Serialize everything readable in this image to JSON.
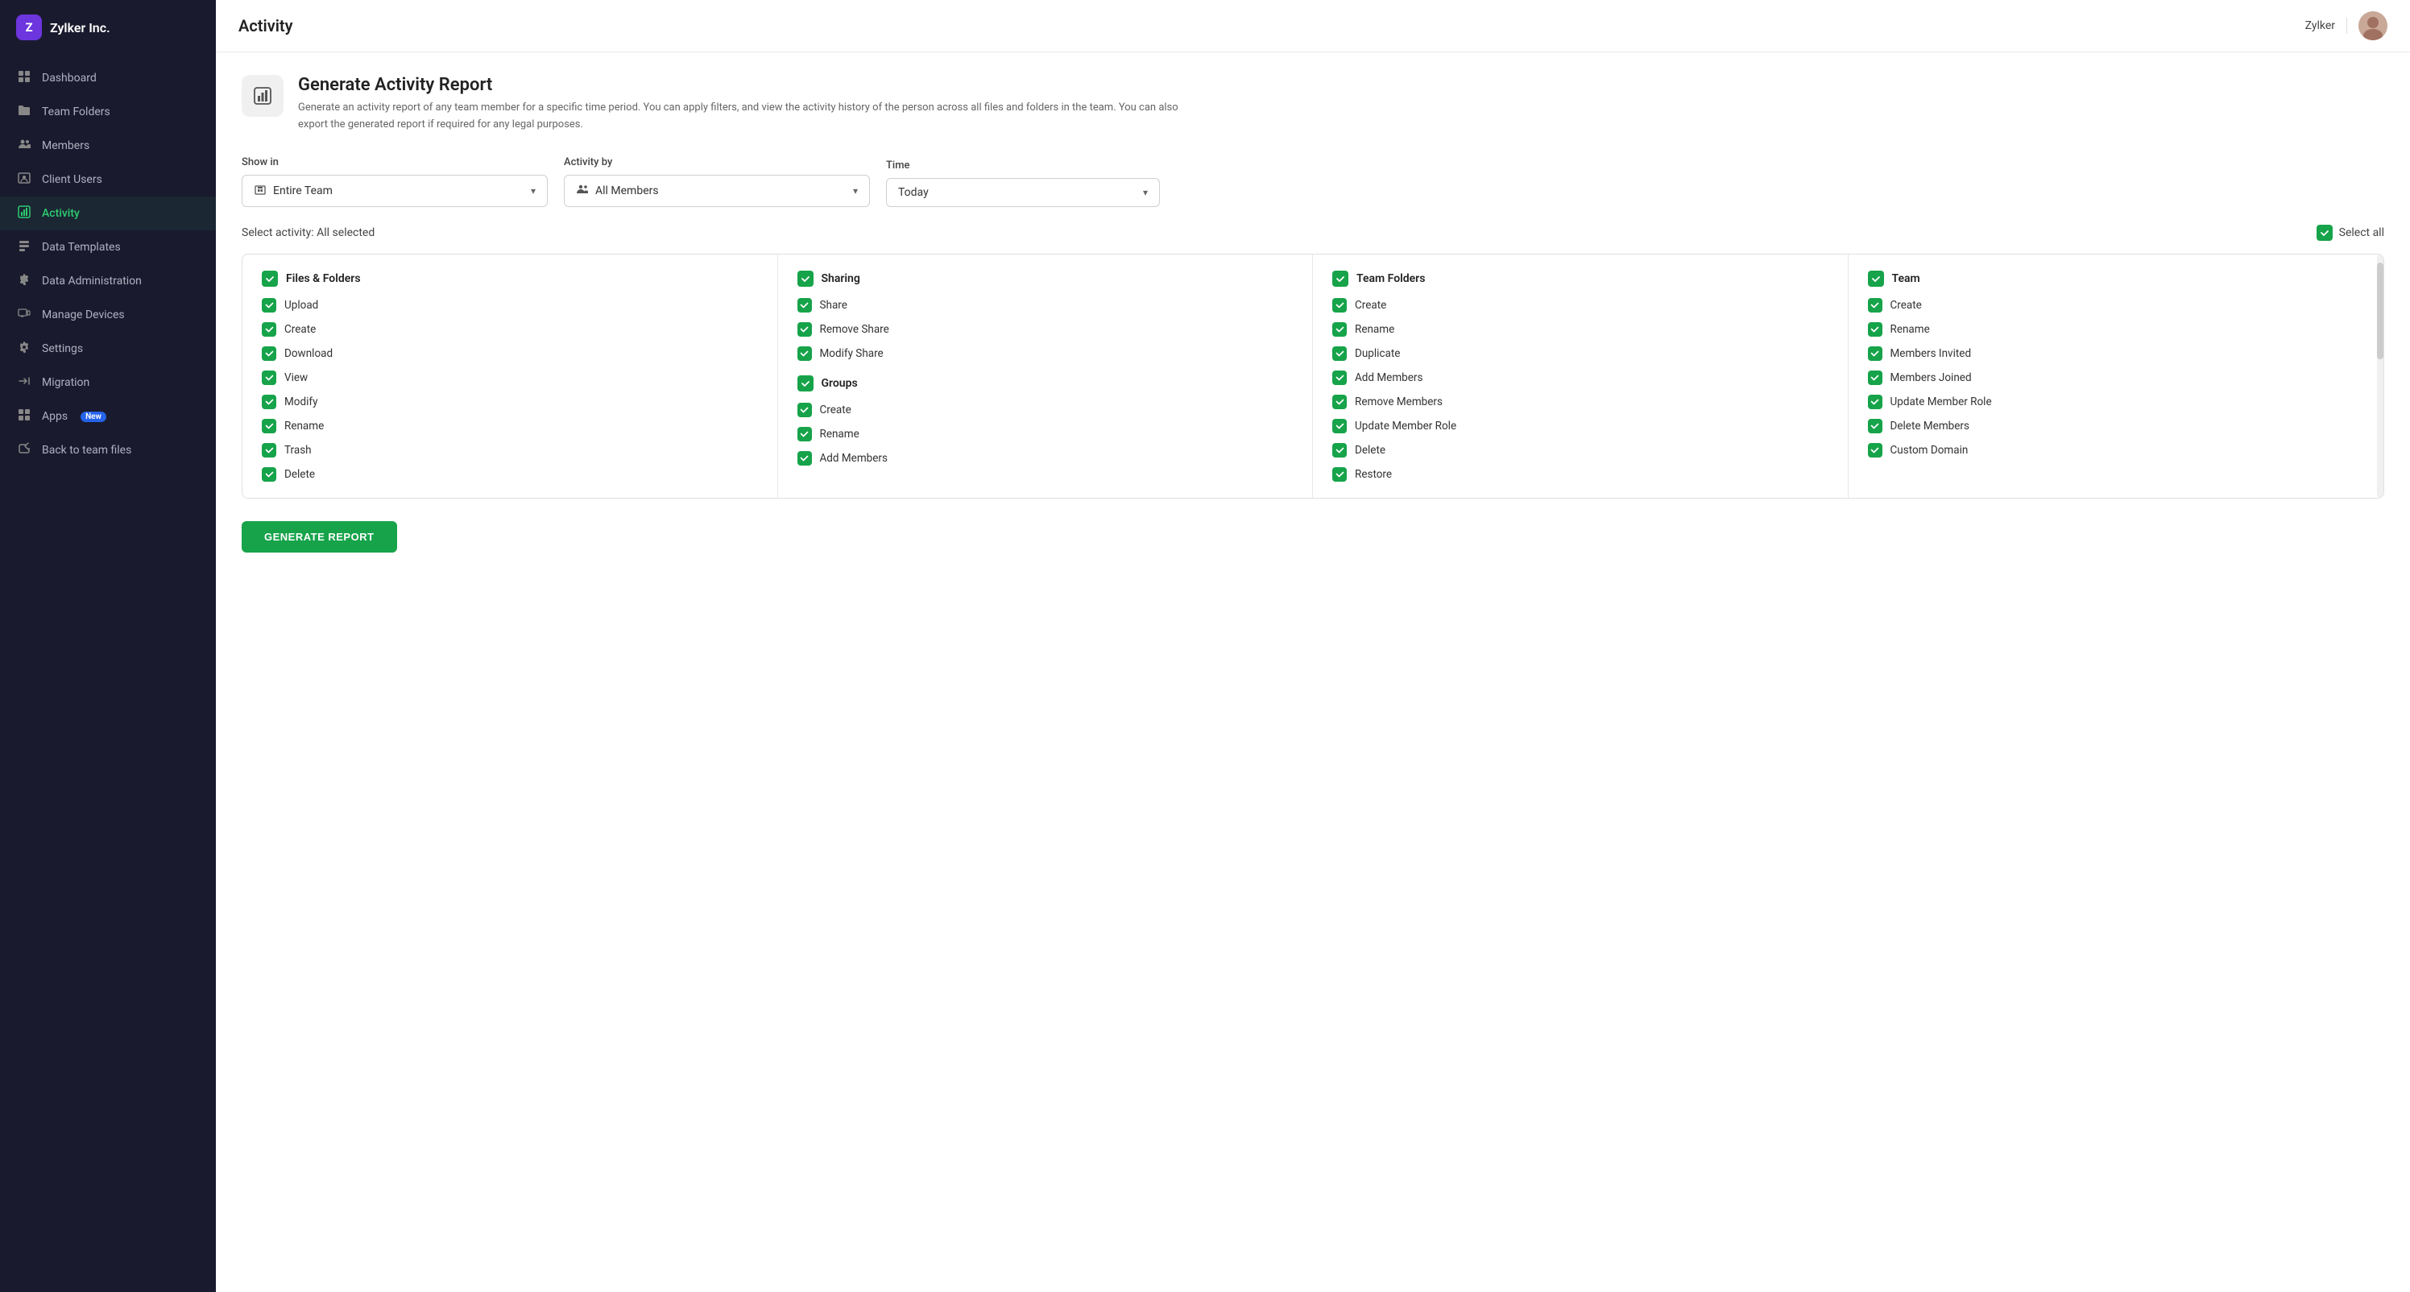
{
  "app": {
    "name": "Zylker Inc.",
    "logo_letter": "Z"
  },
  "sidebar": {
    "items": [
      {
        "id": "dashboard",
        "label": "Dashboard",
        "icon": "⊞"
      },
      {
        "id": "team-folders",
        "label": "Team Folders",
        "icon": "📁"
      },
      {
        "id": "members",
        "label": "Members",
        "icon": "👥"
      },
      {
        "id": "client-users",
        "label": "Client Users",
        "icon": "🪪"
      },
      {
        "id": "activity",
        "label": "Activity",
        "icon": "📊",
        "active": true
      },
      {
        "id": "data-templates",
        "label": "Data Templates",
        "icon": "🗂"
      },
      {
        "id": "data-administration",
        "label": "Data Administration",
        "icon": "⚙"
      },
      {
        "id": "manage-devices",
        "label": "Manage Devices",
        "icon": "🖥"
      },
      {
        "id": "settings",
        "label": "Settings",
        "icon": "⚙"
      },
      {
        "id": "migration",
        "label": "Migration",
        "icon": "🔄"
      },
      {
        "id": "apps",
        "label": "Apps",
        "icon": "⊞",
        "badge": "New"
      },
      {
        "id": "back-to-team-files",
        "label": "Back to team files",
        "icon": "↩"
      }
    ]
  },
  "topbar": {
    "title": "Activity",
    "username": "Zylker"
  },
  "report": {
    "title": "Generate Activity Report",
    "description": "Generate an activity report of any team member for a specific time period. You can apply filters, and view the activity history of the person across all files and folders in the team. You can also export the generated report if required for any legal purposes."
  },
  "filters": {
    "show_in_label": "Show in",
    "show_in_value": "Entire Team",
    "activity_by_label": "Activity by",
    "activity_by_value": "All Members",
    "time_label": "Time",
    "time_value": "Today"
  },
  "activity": {
    "select_label": "Select activity: All selected",
    "select_all_label": "Select all",
    "columns": [
      {
        "id": "files-folders",
        "header": "Files & Folders",
        "items": [
          "Upload",
          "Create",
          "Download",
          "View",
          "Modify",
          "Rename",
          "Trash",
          "Delete"
        ]
      },
      {
        "id": "sharing",
        "header": "Sharing",
        "items": [
          "Share",
          "Remove Share",
          "Modify Share"
        ],
        "sub_sections": [
          {
            "header": "Groups",
            "items": [
              "Create",
              "Rename",
              "Add Members"
            ]
          }
        ]
      },
      {
        "id": "team-folders",
        "header": "Team Folders",
        "items": [
          "Create",
          "Rename",
          "Duplicate",
          "Add Members",
          "Remove Members",
          "Update Member Role",
          "Delete",
          "Restore"
        ]
      },
      {
        "id": "team",
        "header": "Team",
        "items": [
          "Create",
          "Rename",
          "Members Invited",
          "Members Joined",
          "Update Member Role",
          "Delete Members",
          "Custom Domain"
        ]
      }
    ]
  },
  "generate_button_label": "GENERATE REPORT"
}
